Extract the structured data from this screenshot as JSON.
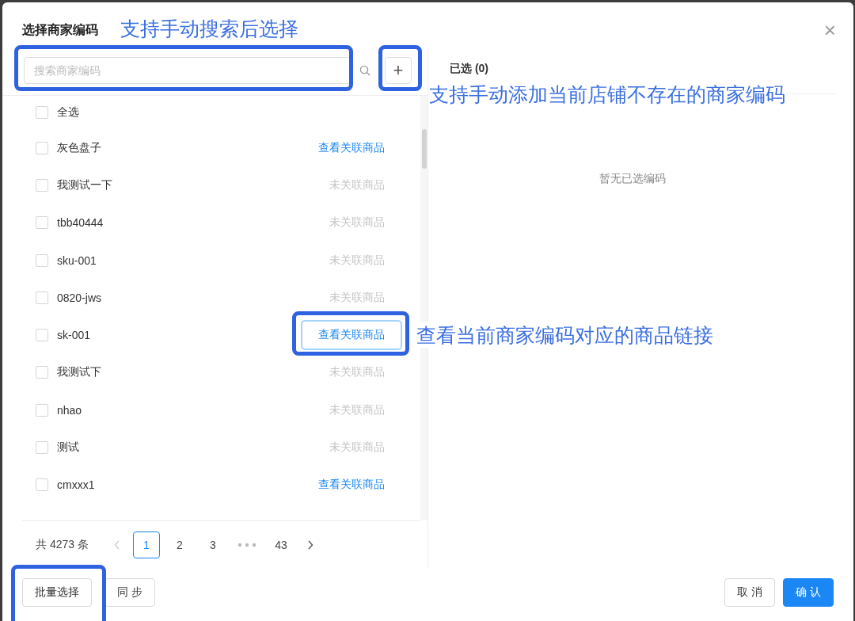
{
  "dialog": {
    "title": "选择商家编码",
    "close": "×"
  },
  "search": {
    "placeholder": "搜索商家编码",
    "add": "+"
  },
  "select_all": {
    "label": "全选",
    "checked": false
  },
  "items": [
    {
      "name": "灰色盘子",
      "checked": false,
      "linked": true,
      "highlighted": false,
      "action": "查看关联商品"
    },
    {
      "name": "我测试一下",
      "checked": false,
      "linked": false,
      "highlighted": false,
      "action": "未关联商品"
    },
    {
      "name": "tbb40444",
      "checked": false,
      "linked": false,
      "highlighted": false,
      "action": "未关联商品"
    },
    {
      "name": "sku-001",
      "checked": false,
      "linked": false,
      "highlighted": false,
      "action": "未关联商品"
    },
    {
      "name": "0820-jws",
      "checked": false,
      "linked": false,
      "highlighted": false,
      "action": "未关联商品"
    },
    {
      "name": "sk-001",
      "checked": false,
      "linked": true,
      "highlighted": true,
      "action": "查看关联商品"
    },
    {
      "name": "我测试下",
      "checked": false,
      "linked": false,
      "highlighted": false,
      "action": "未关联商品"
    },
    {
      "name": "nhao",
      "checked": false,
      "linked": false,
      "highlighted": false,
      "action": "未关联商品"
    },
    {
      "name": "测试",
      "checked": false,
      "linked": false,
      "highlighted": false,
      "action": "未关联商品"
    },
    {
      "name": "cmxxx1",
      "checked": false,
      "linked": true,
      "highlighted": false,
      "action": "查看关联商品"
    }
  ],
  "pagination": {
    "total": "共 4273 条",
    "pages": [
      {
        "label": "1",
        "selected": true
      },
      {
        "label": "2",
        "selected": false
      },
      {
        "label": "3",
        "selected": false
      },
      {
        "kind": "ellipsis"
      },
      {
        "label": "43",
        "selected": false
      }
    ]
  },
  "selected_panel": {
    "title": "已选 (0)",
    "empty": "暂无已选编码"
  },
  "footer": {
    "left_buttons": [
      "批量选择",
      "同 步"
    ],
    "cancel": "取 消",
    "confirm": "确 认"
  },
  "annotations": [
    {
      "text": "支持手动搜索后选择"
    },
    {
      "text": "支持手动添加当前店铺不存在的商家编码"
    },
    {
      "text": "查看当前商家编码对应的商品链接"
    }
  ]
}
